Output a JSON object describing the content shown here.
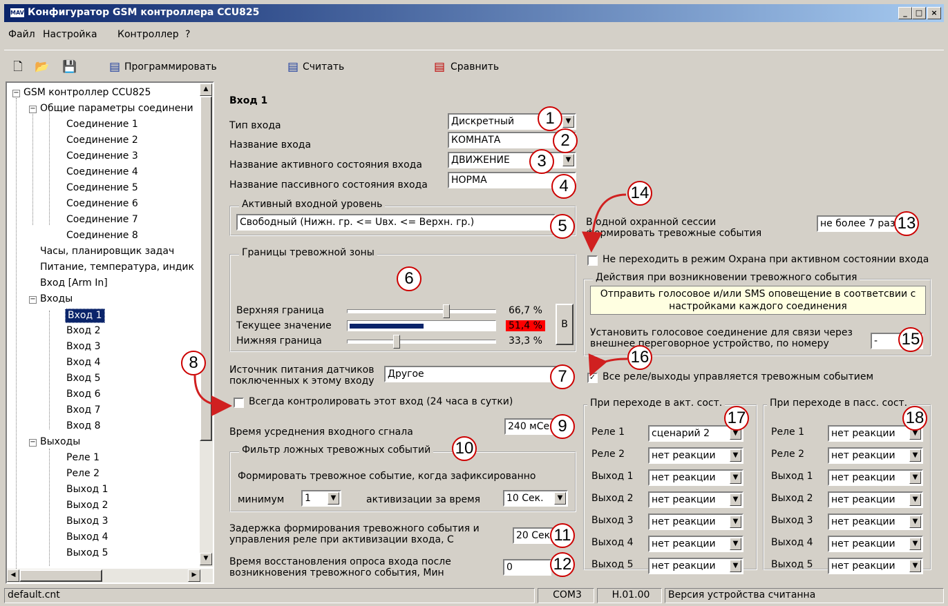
{
  "window": {
    "title": "Конфигуратор GSM контроллера CCU825",
    "app_icon": "MAVS",
    "minimize": "_",
    "maximize": "□",
    "close": "×"
  },
  "menu": [
    "Файл",
    "Настройка",
    "Контроллер",
    "?"
  ],
  "toolbar": {
    "program": "Программировать",
    "read": "Считать",
    "compare": "Сравнить"
  },
  "tree": {
    "root": "GSM контроллер CCU825",
    "general": "Общие параметры соединени",
    "connections": [
      "Соединение 1",
      "Соединение 2",
      "Соединение 3",
      "Соединение 4",
      "Соединение 5",
      "Соединение 6",
      "Соединение 7",
      "Соединение 8"
    ],
    "clock": "Часы, планировщик задач",
    "power": "Питание, температура, индик",
    "arm": "Вход [Arm In]",
    "inputs_label": "Входы",
    "inputs": [
      "Вход 1",
      "Вход 2",
      "Вход 3",
      "Вход 4",
      "Вход 5",
      "Вход 6",
      "Вход 7",
      "Вход 8"
    ],
    "outputs_label": "Выходы",
    "outputs": [
      "Реле 1",
      "Реле 2",
      "Выход 1",
      "Выход 2",
      "Выход 3",
      "Выход 4",
      "Выход 5"
    ]
  },
  "form": {
    "heading": "Вход 1",
    "input_type_label": "Тип входа",
    "input_type_value": "Дискретный",
    "input_name_label": "Название входа",
    "input_name_value": "КОМНАТА",
    "active_state_label": "Название активного состояния входа",
    "active_state_value": "ДВИЖЕНИЕ",
    "passive_state_label": "Название пассивного состояния входа",
    "passive_state_value": "НОРМА",
    "active_level_group": "Активный входной уровень",
    "active_level_value": "Свободный (Нижн. гр. <= Uвх. <= Верхн. гр.)",
    "alarm_zone_group": "Границы тревожной зоны",
    "upper_label": "Верхняя граница",
    "upper_value": "66,7 %",
    "upper_fraction": 0.667,
    "current_label": "Текущее значение",
    "current_value": "51,4 %",
    "current_fraction": 0.514,
    "lower_label": "Нижняя граница",
    "lower_value": "33,3 %",
    "lower_fraction": 0.333,
    "unit_button": "В",
    "sensor_power_label_1": "Источник питания датчиков",
    "sensor_power_label_2": "поключенных к этому входу",
    "sensor_power_value": "Другое",
    "always_control": "Всегда контролировать этот вход (24 часа в сутки)",
    "averaging_label": "Время усреднения входного сгнала",
    "averaging_value": "240 мСек",
    "false_alarm_group": "Фильтр ложных тревожных событий",
    "false_alarm_text": "Формировать тревожное событие, когда зафиксированно",
    "minimum_label": "минимум",
    "minimum_value": "1",
    "activations_label": "активизации за время",
    "activations_value": "10 Сек.",
    "delay_label_1": "Задержка формирования тревожного события и",
    "delay_label_2": "управления реле при активизации входа, С",
    "delay_value": "20 Сек",
    "restore_label_1": "Время восстановления опроса входа  после",
    "restore_label_2": "возникновения тревожного события, Мин",
    "restore_value": "0",
    "session_label_1": "В одной охранной сессии",
    "session_label_2": "формировать тревожные события",
    "session_value": "не более 7 раз",
    "no_guard_mode": "Не переходить в режим Охрана при активном состоянии входа",
    "actions_group": "Действия при возникновении тревожного события",
    "actions_info_1": "Отправить голосовое и/или SMS оповещение в соответсвии с",
    "actions_info_2": "настройками каждого соединения",
    "voice_label_1": "Установить голосовое соединение для связи через",
    "voice_label_2": "внешнее переговорное устройство, по номеру",
    "voice_value": "-",
    "all_relays": "Все реле/выходы управляется тревожным событием",
    "act_group": "При переходе в акт. сост.",
    "pass_group": "При переходе в пасс. сост.",
    "rows": [
      "Реле 1",
      "Реле 2",
      "Выход 1",
      "Выход 2",
      "Выход 3",
      "Выход 4",
      "Выход 5"
    ],
    "act_values": [
      "сценарий 2",
      "нет реакции",
      "нет реакции",
      "нет реакции",
      "нет реакции",
      "нет реакции",
      "нет реакции"
    ],
    "pass_values": [
      "нет реакции",
      "нет реакции",
      "нет реакции",
      "нет реакции",
      "нет реакции",
      "нет реакции",
      "нет реакции"
    ]
  },
  "callouts": [
    "1",
    "2",
    "3",
    "4",
    "5",
    "6",
    "7",
    "8",
    "9",
    "10",
    "11",
    "12",
    "13",
    "14",
    "15",
    "16",
    "17",
    "18"
  ],
  "status": {
    "file": "default.cnt",
    "port": "COM3",
    "version": "H.01.00",
    "message": "Версия устройства считанна"
  },
  "colors": {
    "title_start": "#0a246a",
    "title_end": "#a6caf0",
    "selection": "#0a246a",
    "current_bar": "#0a246a",
    "current_value_bg": "#ff0000",
    "callout_border": "#c00000",
    "arrow": "#d02020"
  }
}
